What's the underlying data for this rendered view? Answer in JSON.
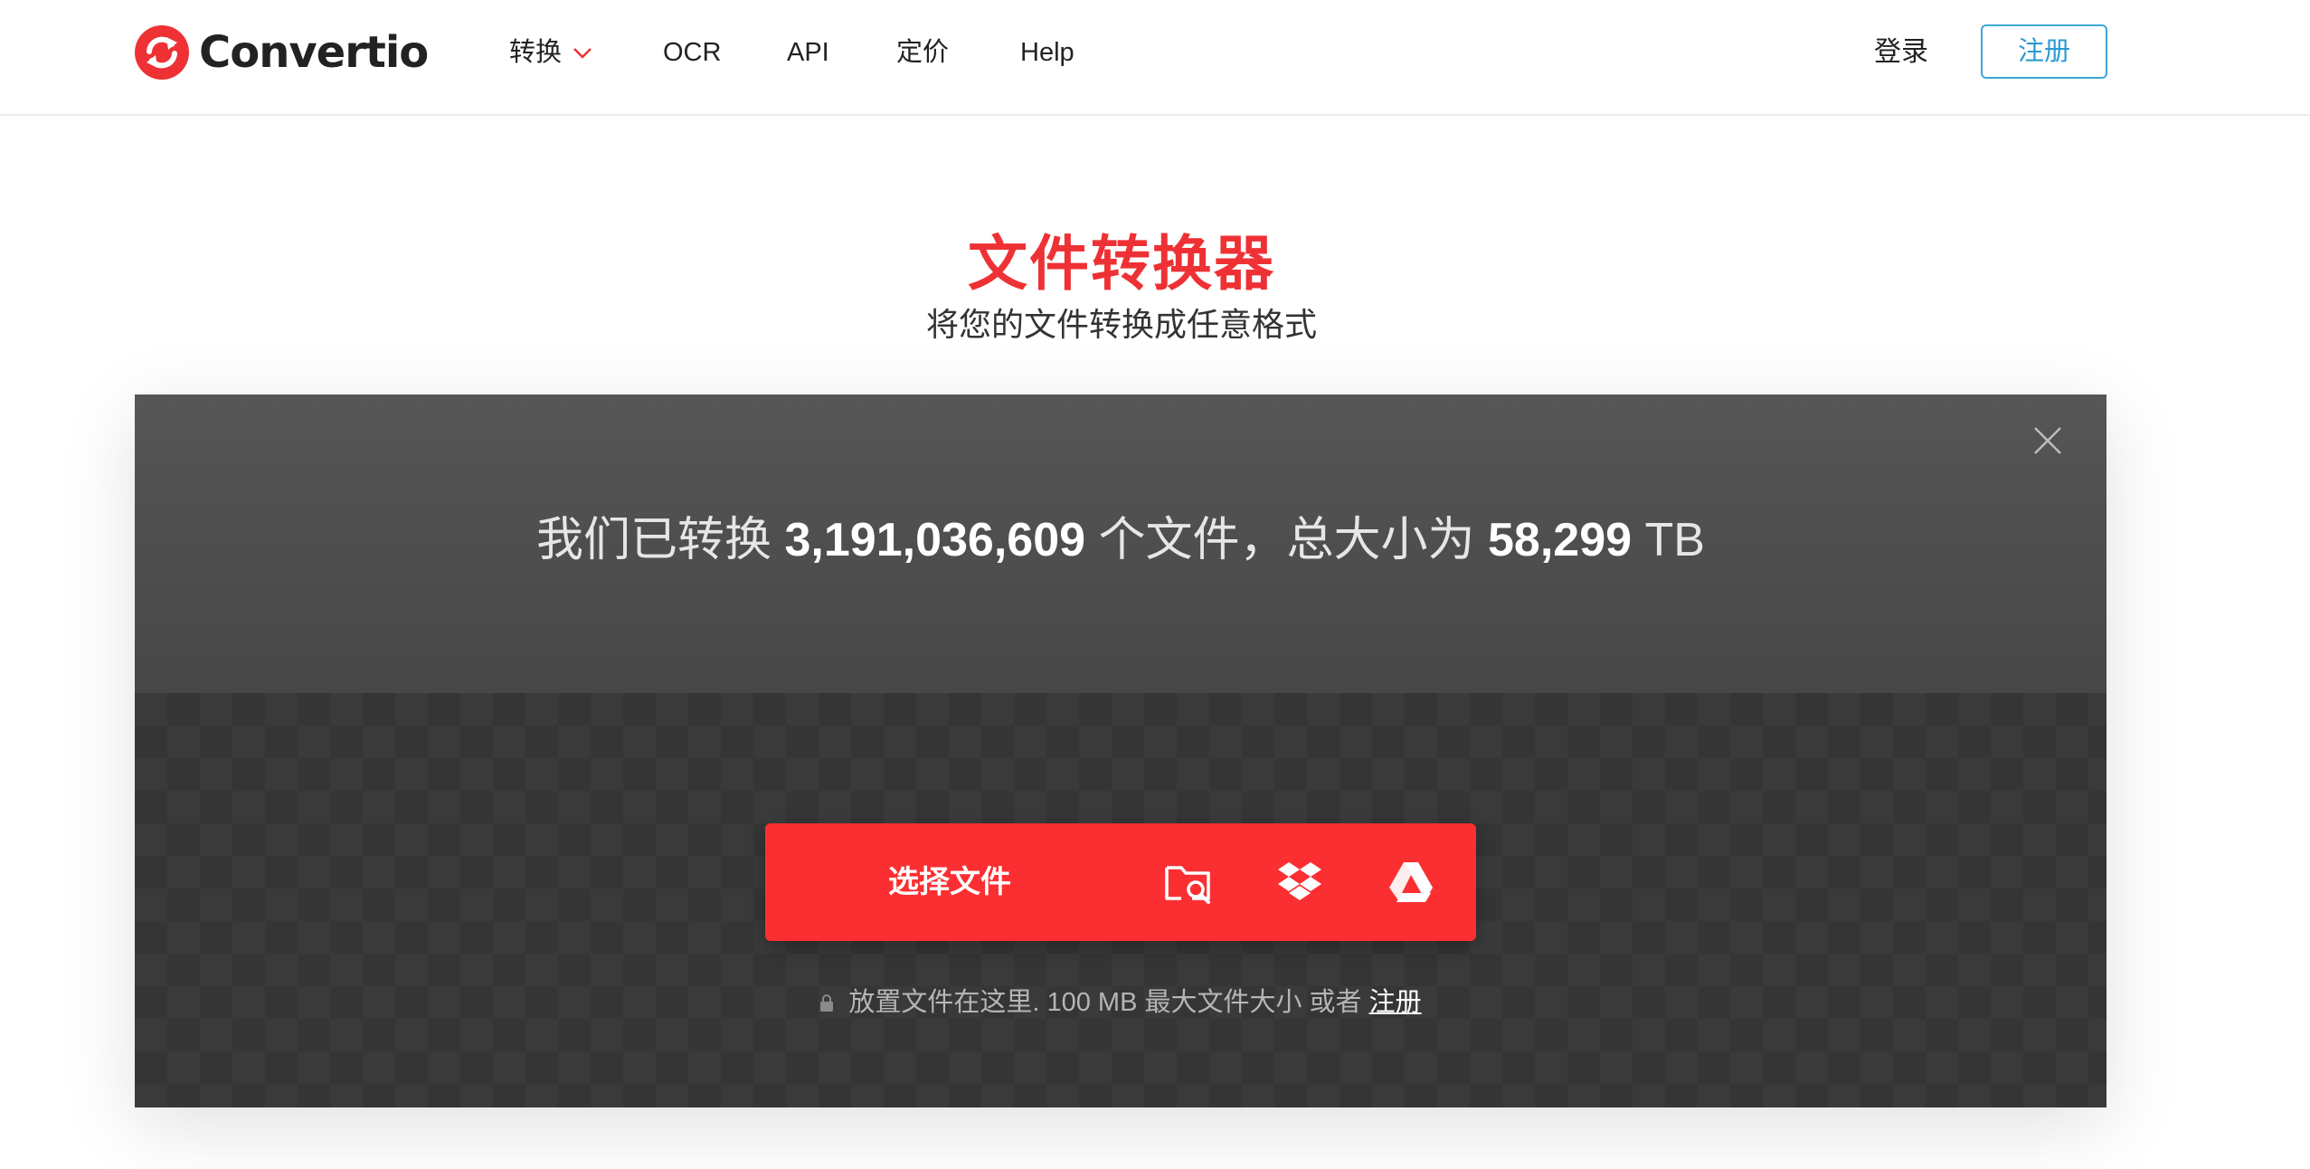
{
  "brand": {
    "name": "Convertio",
    "accent": "#ee3134"
  },
  "nav": [
    {
      "label": "转换",
      "has_dropdown": true
    },
    {
      "label": "OCR"
    },
    {
      "label": "API"
    },
    {
      "label": "定价"
    },
    {
      "label": "Help"
    }
  ],
  "auth": {
    "login": "登录",
    "signup": "注册"
  },
  "hero": {
    "title": "文件转换器",
    "subtitle": "将您的文件转换成任意格式"
  },
  "stats": {
    "prefix": "我们已转换",
    "files_count": "3,191,036,609",
    "middle": "个文件，总大小为",
    "total_size": "58,299",
    "unit": "TB"
  },
  "upload": {
    "choose_label": "选择文件",
    "sources": [
      "folder-search-icon",
      "dropbox-icon",
      "google-drive-icon"
    ],
    "hint_prefix": "放置文件在这里. 100 MB 最大文件大小 或者",
    "hint_link": "注册"
  }
}
